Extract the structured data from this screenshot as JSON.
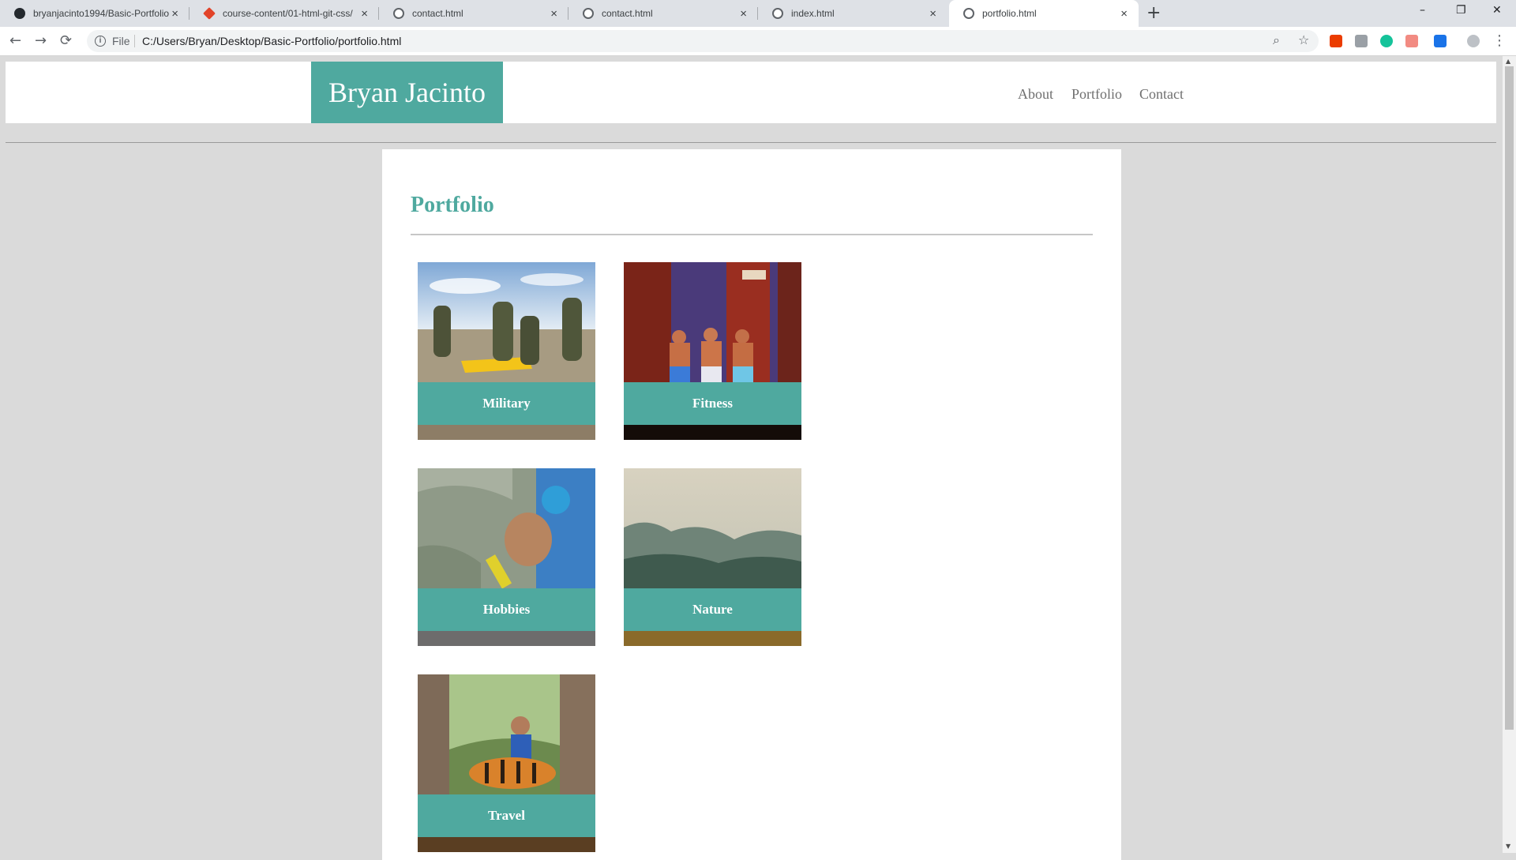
{
  "browser": {
    "tabs": [
      {
        "title": "bryanjacinto1994/Basic-Portfolio",
        "icon": "github-icon"
      },
      {
        "title": "course-content/01-html-git-css/",
        "icon": "gitlab-icon"
      },
      {
        "title": "contact.html",
        "icon": "globe-icon"
      },
      {
        "title": "contact.html",
        "icon": "globe-icon"
      },
      {
        "title": "index.html",
        "icon": "globe-icon"
      },
      {
        "title": "portfolio.html",
        "icon": "globe-icon"
      }
    ],
    "active_tab_index": 5,
    "new_tab_label": "+",
    "window_controls": {
      "minimize": "–",
      "restore": "❐",
      "close": "✕"
    },
    "nav": {
      "back": "←",
      "forward": "→",
      "reload": "⟳"
    },
    "address": {
      "scheme_label": "File",
      "url": "C:/Users/Bryan/Desktop/Basic-Portfolio/portfolio.html"
    },
    "omnibox_icons": {
      "zoom": "⌕",
      "bookmark": "☆"
    },
    "extensions": [
      {
        "name": "office-extension-icon",
        "color": "#eb3c00"
      },
      {
        "name": "pdf-extension-icon",
        "color": "#9aa0a6"
      },
      {
        "name": "grammarly-extension-icon",
        "color": "#15c39a"
      },
      {
        "name": "arrow-extension-icon",
        "color": "#f28b82"
      },
      {
        "name": "pen-extension-icon",
        "color": "#1a73e8"
      },
      {
        "name": "profile-avatar-icon",
        "color": "#bdc1c6"
      }
    ],
    "menu_icon": "⋮"
  },
  "site": {
    "brand": "Bryan Jacinto",
    "nav": [
      "About",
      "Portfolio",
      "Contact"
    ],
    "page_title": "Portfolio",
    "accent_color": "#4fa99f",
    "cards": [
      {
        "caption": "Military"
      },
      {
        "caption": "Fitness"
      },
      {
        "caption": "Hobbies"
      },
      {
        "caption": "Nature"
      },
      {
        "caption": "Travel"
      }
    ]
  }
}
